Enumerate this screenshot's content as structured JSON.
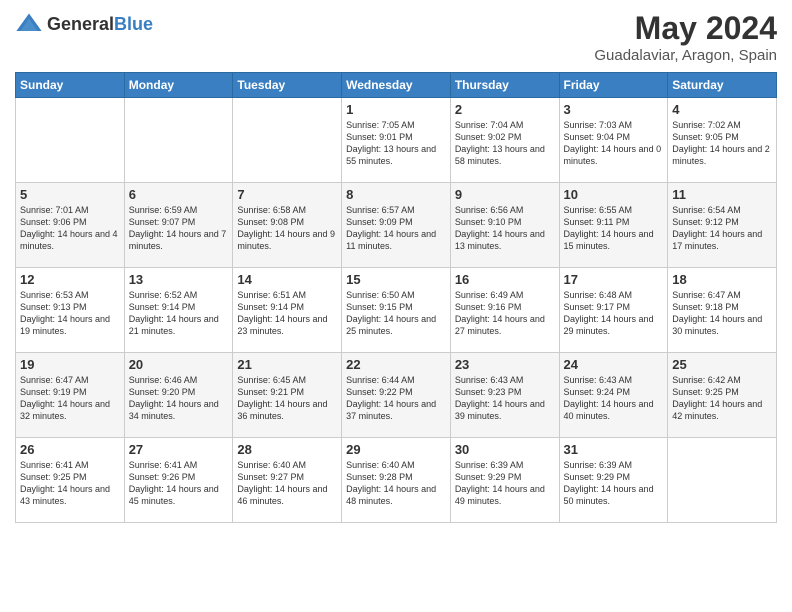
{
  "header": {
    "logo_general": "General",
    "logo_blue": "Blue",
    "month_title": "May 2024",
    "location": "Guadalaviar, Aragon, Spain"
  },
  "days_of_week": [
    "Sunday",
    "Monday",
    "Tuesday",
    "Wednesday",
    "Thursday",
    "Friday",
    "Saturday"
  ],
  "weeks": [
    [
      {
        "day": "",
        "content": ""
      },
      {
        "day": "",
        "content": ""
      },
      {
        "day": "",
        "content": ""
      },
      {
        "day": "1",
        "content": "Sunrise: 7:05 AM\nSunset: 9:01 PM\nDaylight: 13 hours\nand 55 minutes."
      },
      {
        "day": "2",
        "content": "Sunrise: 7:04 AM\nSunset: 9:02 PM\nDaylight: 13 hours\nand 58 minutes."
      },
      {
        "day": "3",
        "content": "Sunrise: 7:03 AM\nSunset: 9:04 PM\nDaylight: 14 hours\nand 0 minutes."
      },
      {
        "day": "4",
        "content": "Sunrise: 7:02 AM\nSunset: 9:05 PM\nDaylight: 14 hours\nand 2 minutes."
      }
    ],
    [
      {
        "day": "5",
        "content": "Sunrise: 7:01 AM\nSunset: 9:06 PM\nDaylight: 14 hours\nand 4 minutes."
      },
      {
        "day": "6",
        "content": "Sunrise: 6:59 AM\nSunset: 9:07 PM\nDaylight: 14 hours\nand 7 minutes."
      },
      {
        "day": "7",
        "content": "Sunrise: 6:58 AM\nSunset: 9:08 PM\nDaylight: 14 hours\nand 9 minutes."
      },
      {
        "day": "8",
        "content": "Sunrise: 6:57 AM\nSunset: 9:09 PM\nDaylight: 14 hours\nand 11 minutes."
      },
      {
        "day": "9",
        "content": "Sunrise: 6:56 AM\nSunset: 9:10 PM\nDaylight: 14 hours\nand 13 minutes."
      },
      {
        "day": "10",
        "content": "Sunrise: 6:55 AM\nSunset: 9:11 PM\nDaylight: 14 hours\nand 15 minutes."
      },
      {
        "day": "11",
        "content": "Sunrise: 6:54 AM\nSunset: 9:12 PM\nDaylight: 14 hours\nand 17 minutes."
      }
    ],
    [
      {
        "day": "12",
        "content": "Sunrise: 6:53 AM\nSunset: 9:13 PM\nDaylight: 14 hours\nand 19 minutes."
      },
      {
        "day": "13",
        "content": "Sunrise: 6:52 AM\nSunset: 9:14 PM\nDaylight: 14 hours\nand 21 minutes."
      },
      {
        "day": "14",
        "content": "Sunrise: 6:51 AM\nSunset: 9:14 PM\nDaylight: 14 hours\nand 23 minutes."
      },
      {
        "day": "15",
        "content": "Sunrise: 6:50 AM\nSunset: 9:15 PM\nDaylight: 14 hours\nand 25 minutes."
      },
      {
        "day": "16",
        "content": "Sunrise: 6:49 AM\nSunset: 9:16 PM\nDaylight: 14 hours\nand 27 minutes."
      },
      {
        "day": "17",
        "content": "Sunrise: 6:48 AM\nSunset: 9:17 PM\nDaylight: 14 hours\nand 29 minutes."
      },
      {
        "day": "18",
        "content": "Sunrise: 6:47 AM\nSunset: 9:18 PM\nDaylight: 14 hours\nand 30 minutes."
      }
    ],
    [
      {
        "day": "19",
        "content": "Sunrise: 6:47 AM\nSunset: 9:19 PM\nDaylight: 14 hours\nand 32 minutes."
      },
      {
        "day": "20",
        "content": "Sunrise: 6:46 AM\nSunset: 9:20 PM\nDaylight: 14 hours\nand 34 minutes."
      },
      {
        "day": "21",
        "content": "Sunrise: 6:45 AM\nSunset: 9:21 PM\nDaylight: 14 hours\nand 36 minutes."
      },
      {
        "day": "22",
        "content": "Sunrise: 6:44 AM\nSunset: 9:22 PM\nDaylight: 14 hours\nand 37 minutes."
      },
      {
        "day": "23",
        "content": "Sunrise: 6:43 AM\nSunset: 9:23 PM\nDaylight: 14 hours\nand 39 minutes."
      },
      {
        "day": "24",
        "content": "Sunrise: 6:43 AM\nSunset: 9:24 PM\nDaylight: 14 hours\nand 40 minutes."
      },
      {
        "day": "25",
        "content": "Sunrise: 6:42 AM\nSunset: 9:25 PM\nDaylight: 14 hours\nand 42 minutes."
      }
    ],
    [
      {
        "day": "26",
        "content": "Sunrise: 6:41 AM\nSunset: 9:25 PM\nDaylight: 14 hours\nand 43 minutes."
      },
      {
        "day": "27",
        "content": "Sunrise: 6:41 AM\nSunset: 9:26 PM\nDaylight: 14 hours\nand 45 minutes."
      },
      {
        "day": "28",
        "content": "Sunrise: 6:40 AM\nSunset: 9:27 PM\nDaylight: 14 hours\nand 46 minutes."
      },
      {
        "day": "29",
        "content": "Sunrise: 6:40 AM\nSunset: 9:28 PM\nDaylight: 14 hours\nand 48 minutes."
      },
      {
        "day": "30",
        "content": "Sunrise: 6:39 AM\nSunset: 9:29 PM\nDaylight: 14 hours\nand 49 minutes."
      },
      {
        "day": "31",
        "content": "Sunrise: 6:39 AM\nSunset: 9:29 PM\nDaylight: 14 hours\nand 50 minutes."
      },
      {
        "day": "",
        "content": ""
      }
    ]
  ]
}
